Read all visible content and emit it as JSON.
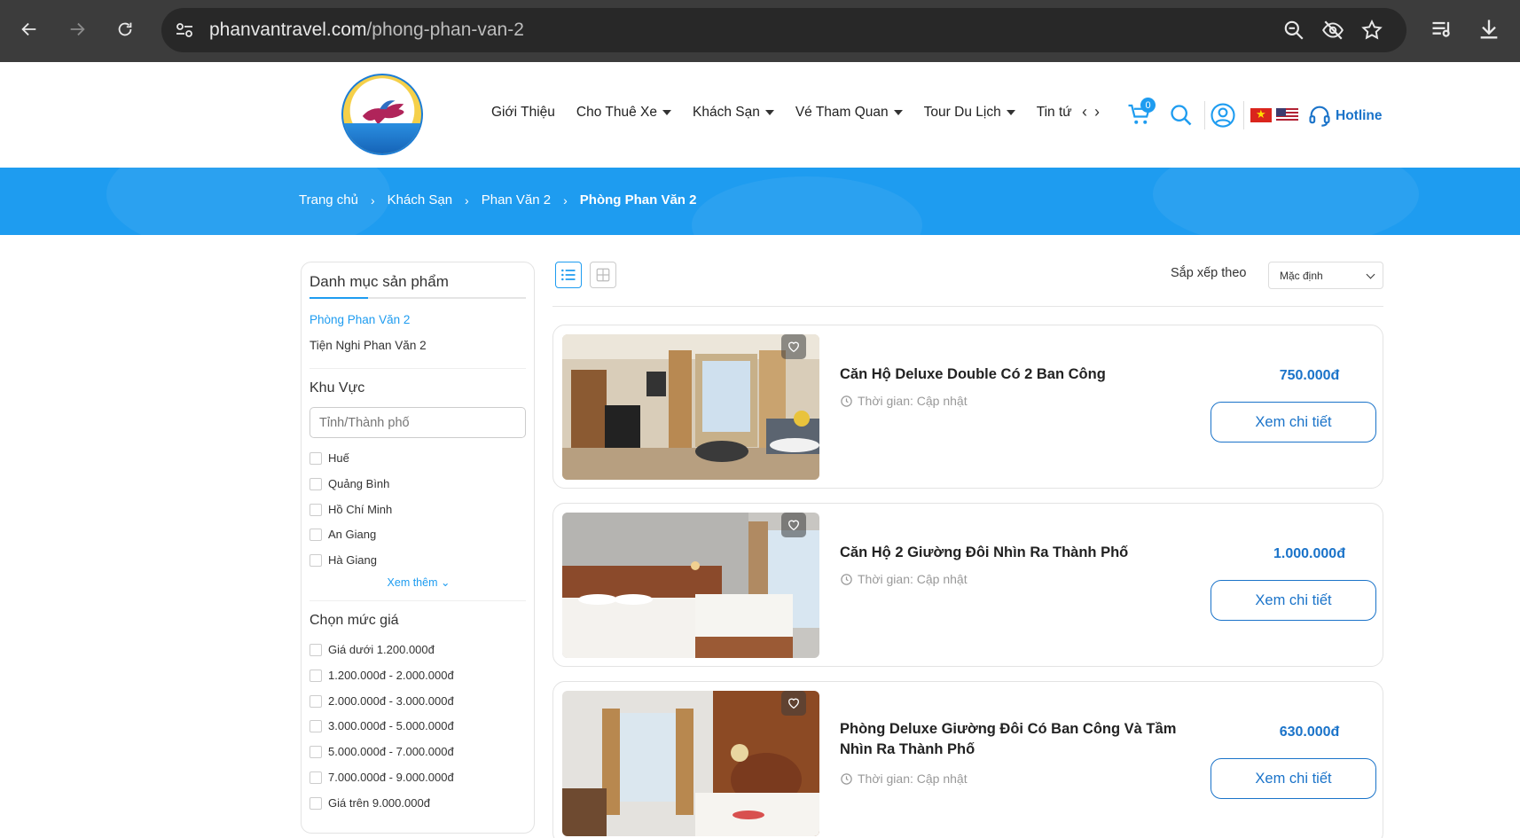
{
  "browser": {
    "url_host": "phanvantravel.com",
    "url_path": "/phong-phan-van-2"
  },
  "header": {
    "menu": [
      "Giới Thiệu",
      "Cho Thuê Xe",
      "Khách Sạn",
      "Vé Tham Quan",
      "Tour Du Lịch",
      "Tin tứ"
    ],
    "menu_has_caret": [
      false,
      true,
      true,
      true,
      true,
      false
    ],
    "cart_count": "0",
    "hotline": "Hotline"
  },
  "breadcrumb": {
    "home": "Trang chủ",
    "level1": "Khách Sạn",
    "level2": "Phan Văn 2",
    "current": "Phòng Phan Văn 2"
  },
  "sidebar": {
    "title": "Danh mục sản phẩm",
    "categories": [
      {
        "label": "Phòng Phan Văn 2",
        "active": true
      },
      {
        "label": "Tiện Nghi Phan Văn 2",
        "active": false
      }
    ],
    "region_heading": "Khu Vực",
    "region_placeholder": "Tỉnh/Thành phố",
    "regions": [
      "Huế",
      "Quảng Bình",
      "Hồ Chí Minh",
      "An Giang",
      "Hà Giang"
    ],
    "see_more": "Xem thêm",
    "price_heading": "Chọn mức giá",
    "price_ranges": [
      "Giá dưới 1.200.000đ",
      "1.200.000đ - 2.000.000đ",
      "2.000.000đ - 3.000.000đ",
      "3.000.000đ - 5.000.000đ",
      "5.000.000đ - 7.000.000đ",
      "7.000.000đ - 9.000.000đ",
      "Giá trên 9.000.000đ"
    ]
  },
  "toolbar": {
    "sort_label": "Sắp xếp theo",
    "sort_value": "Mặc định"
  },
  "products": [
    {
      "name": "Căn Hộ Deluxe Double Có 2 Ban Công",
      "time": "Thời gian: Cập nhật",
      "price": "750.000đ",
      "button": "Xem chi tiết"
    },
    {
      "name": "Căn Hộ 2 Giường Đôi Nhìn Ra Thành Phố",
      "time": "Thời gian: Cập nhật",
      "price": "1.000.000đ",
      "button": "Xem chi tiết"
    },
    {
      "name": "Phòng Deluxe Giường Đôi Có Ban Công Và Tầm Nhìn Ra Thành Phố",
      "time": "Thời gian: Cập nhật",
      "price": "630.000đ",
      "button": "Xem chi tiết"
    }
  ],
  "colors": {
    "brand_blue": "#1e9cf0",
    "link_blue": "#1a73c9",
    "chrome_bg": "#3c3c3c"
  }
}
